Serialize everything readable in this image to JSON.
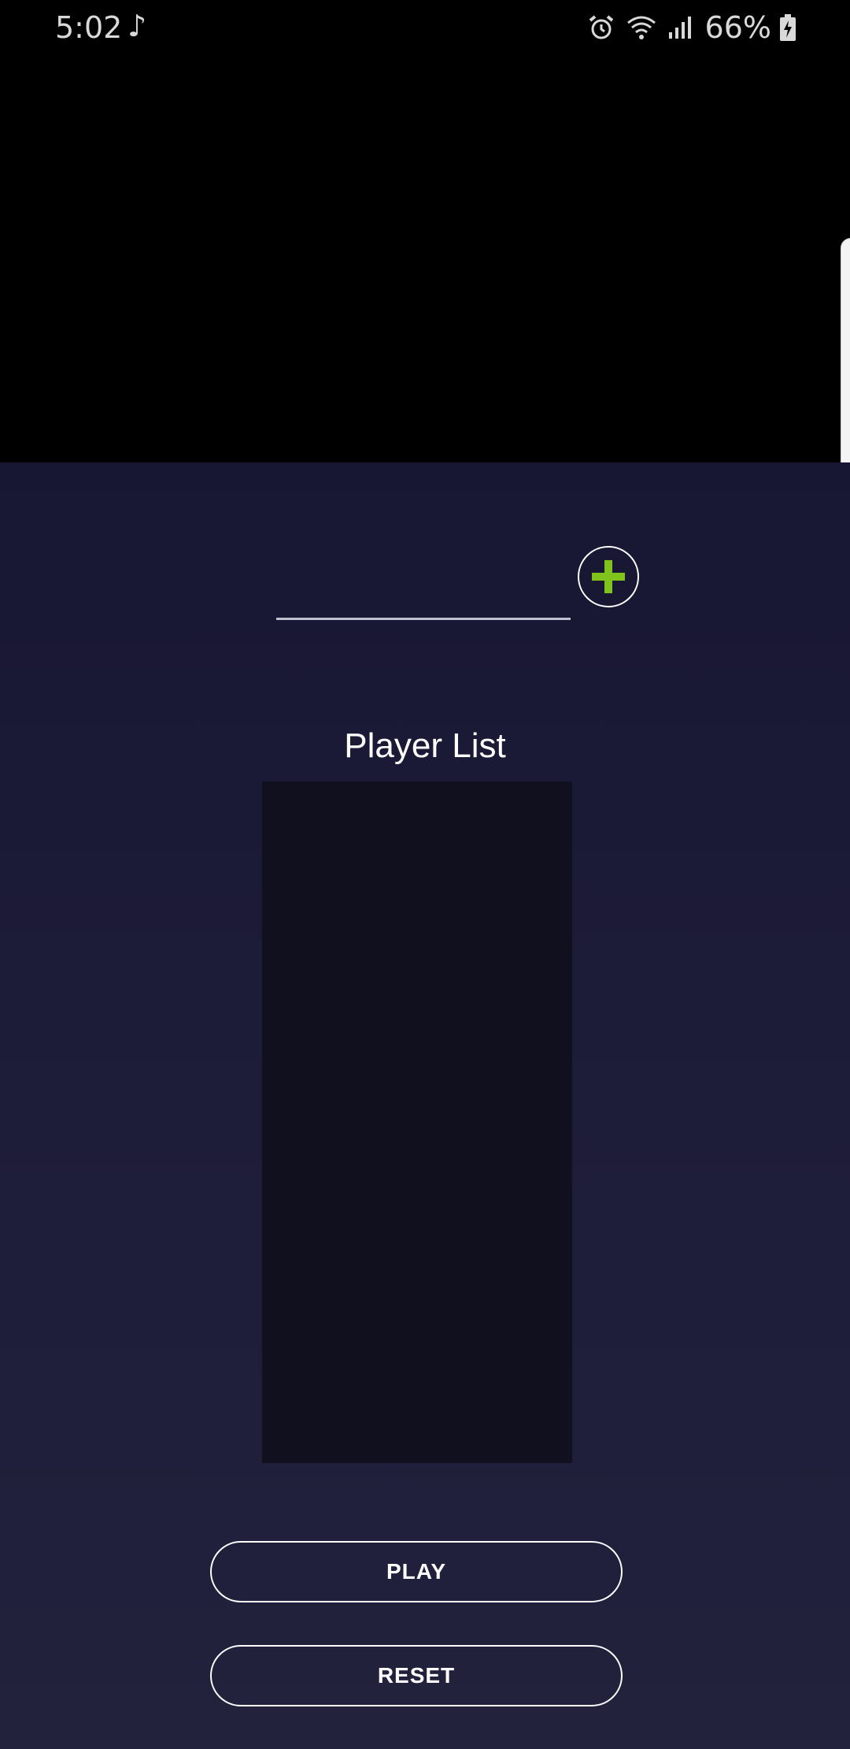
{
  "status_bar": {
    "time": "5:02",
    "music_icon": "music-note-icon",
    "alarm_icon": "alarm-icon",
    "wifi_icon": "wifi-icon",
    "signal_icon": "signal-icon",
    "battery_icon": "battery-charging-icon",
    "battery_percent": "66%"
  },
  "player_input": {
    "value": "",
    "placeholder": ""
  },
  "add_button": {
    "icon": "plus-icon",
    "icon_color": "#7fc31c"
  },
  "player_list": {
    "title": "Player List",
    "items": []
  },
  "actions": {
    "play_label": "PLAY",
    "reset_label": "RESET"
  },
  "colors": {
    "background": "#1b1a37",
    "list_background": "#10101e",
    "accent": "#7fc31c"
  }
}
